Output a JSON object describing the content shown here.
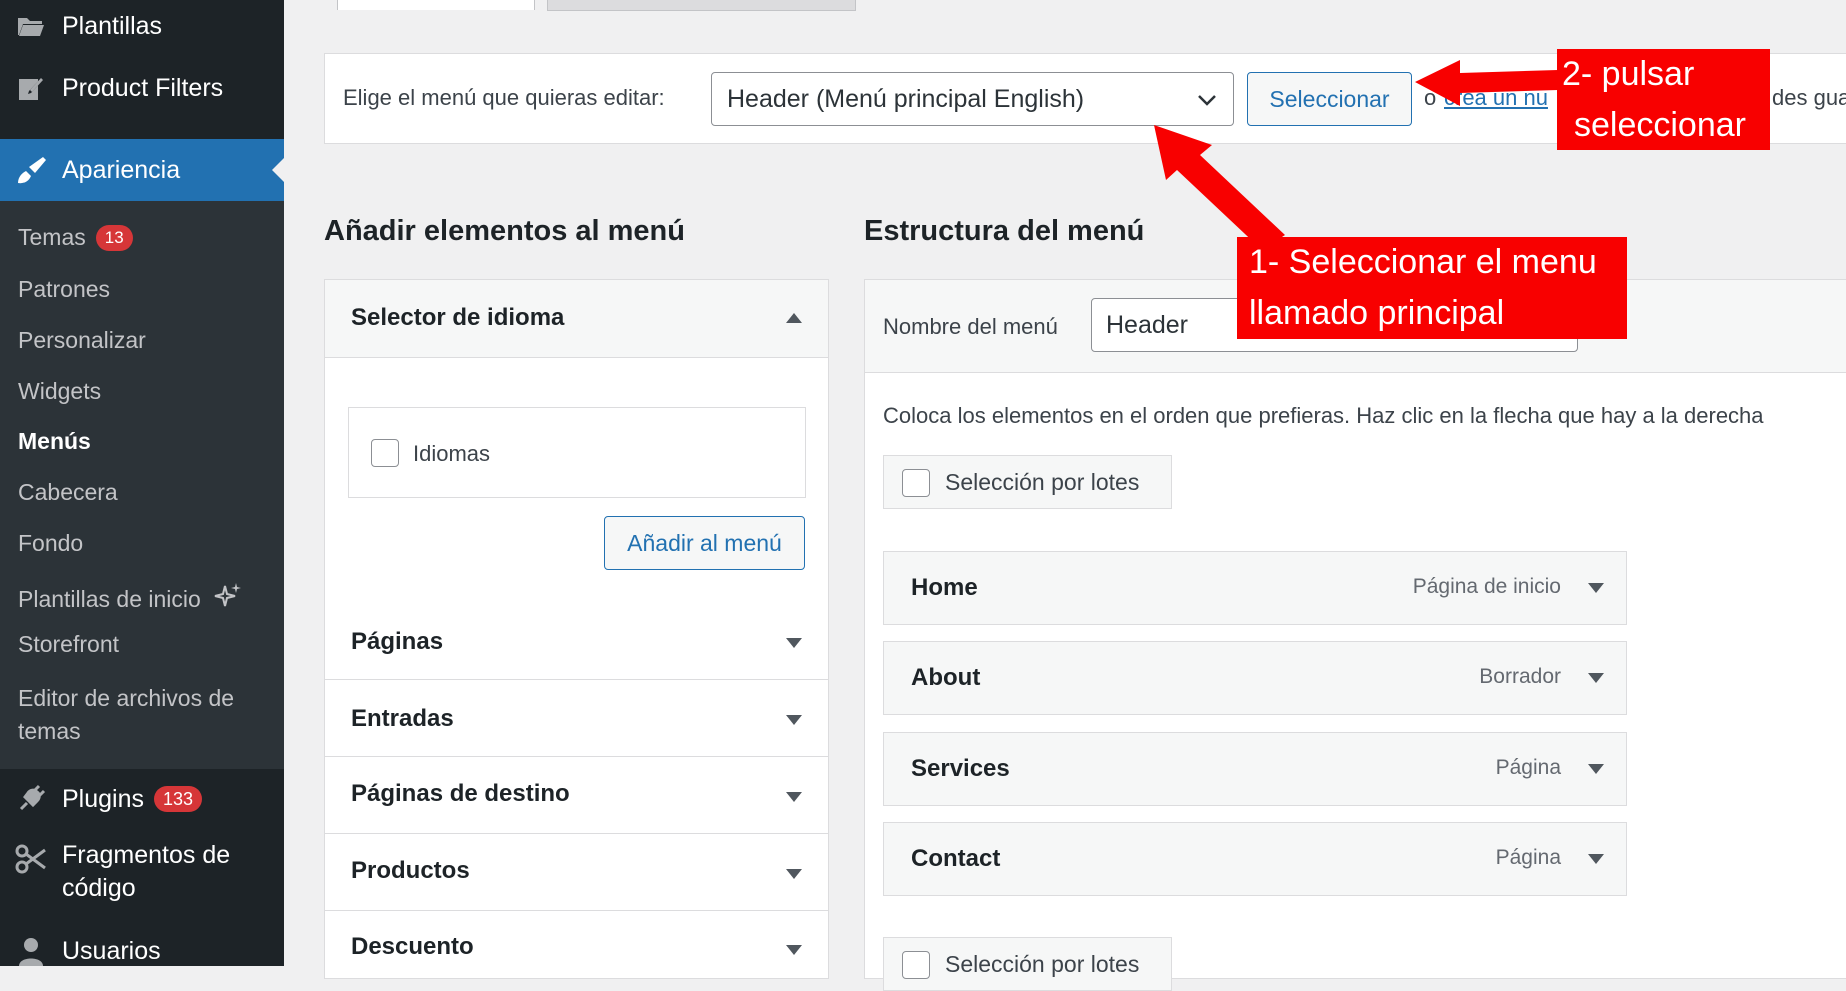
{
  "sidebar": {
    "top_items": [
      {
        "label": "Plantillas",
        "icon": "folder-icon"
      },
      {
        "label": "Product Filters",
        "icon": "edit-icon"
      },
      {
        "label": "Apariencia",
        "icon": "paintbrush-icon"
      }
    ],
    "submenu": [
      {
        "label": "Temas",
        "badge": "13"
      },
      {
        "label": "Patrones"
      },
      {
        "label": "Personalizar"
      },
      {
        "label": "Widgets"
      },
      {
        "label": "Menús"
      },
      {
        "label": "Cabecera"
      },
      {
        "label": "Fondo"
      },
      {
        "label": "Plantillas de inicio",
        "icon": "sparkles-icon"
      },
      {
        "label": "Storefront"
      },
      {
        "label": "Editor de archivos de",
        "label_line2": "temas"
      }
    ],
    "bottom_items": [
      {
        "label": "Plugins",
        "badge": "133",
        "icon": "plugin-icon"
      },
      {
        "label": "Fragmentos de",
        "label_line2": "código",
        "icon": "scissors-icon"
      },
      {
        "label": "Usuarios",
        "icon": "user-icon"
      }
    ]
  },
  "select_bar": {
    "label": "Elige el menú que quieras editar:",
    "selected_menu": "Header (Menú principal English)",
    "select_button": "Seleccionar",
    "trailing_text_1": "o",
    "trailing_link": "crea un nu",
    "trailing_text_2": "des gua"
  },
  "add_items": {
    "heading": "Añadir elementos al menú",
    "language_section": {
      "title": "Selector de idioma",
      "checkbox_label": "Idiomas",
      "add_button": "Añadir al menú"
    },
    "sections": [
      "Páginas",
      "Entradas",
      "Páginas de destino",
      "Productos",
      "Descuento"
    ]
  },
  "structure": {
    "heading": "Estructura del menú",
    "name_label": "Nombre del menú",
    "name_value": "Header",
    "instructions": "Coloca los elementos en el orden que prefieras. Haz clic en la flecha que hay a la derecha",
    "bulk_label": "Selección por lotes",
    "items": [
      {
        "title": "Home",
        "type": "Página de inicio"
      },
      {
        "title": "About",
        "type": "Borrador"
      },
      {
        "title": "Services",
        "type": "Página"
      },
      {
        "title": "Contact",
        "type": "Página"
      }
    ]
  },
  "annotations": {
    "step1_line1": "1- Seleccionar el menu",
    "step1_line2": "llamado principal",
    "step2_line1": "2- pulsar",
    "step2_line2": "seleccionar",
    "color": "#f80000"
  },
  "colors": {
    "sidebar_bg": "#1d2327",
    "submenu_bg": "#2c3338",
    "accent": "#2271b1",
    "badge": "#d63638"
  }
}
